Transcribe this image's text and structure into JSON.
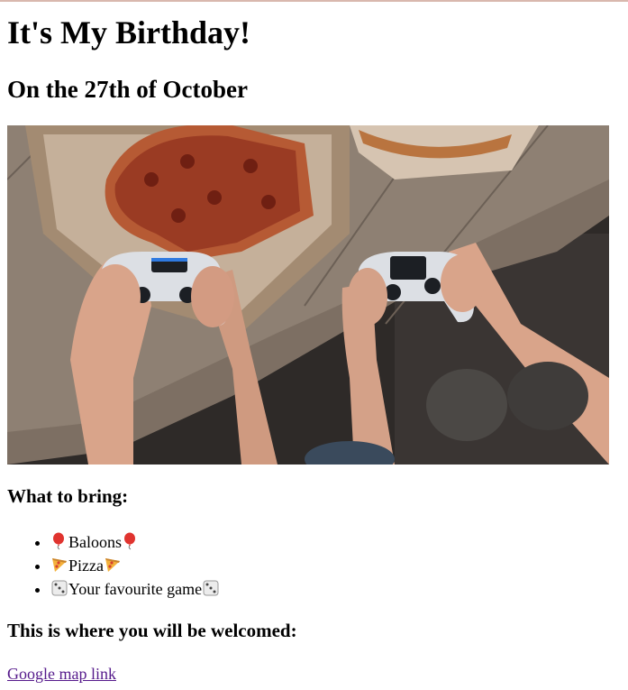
{
  "page": {
    "title": "It's My Birthday!",
    "subtitle": "On the 27th of October"
  },
  "image": {
    "icon": "photo-pizza-and-game-controllers"
  },
  "bring": {
    "heading": "What to bring:",
    "items": [
      {
        "label": "Baloons",
        "icon": "balloon-icon"
      },
      {
        "label": "Pizza",
        "icon": "pizza-icon"
      },
      {
        "label": "Your favourite game",
        "icon": "dice-icon"
      }
    ]
  },
  "location": {
    "heading": "This is where you will be welcomed:",
    "link_text": "Google map link"
  }
}
